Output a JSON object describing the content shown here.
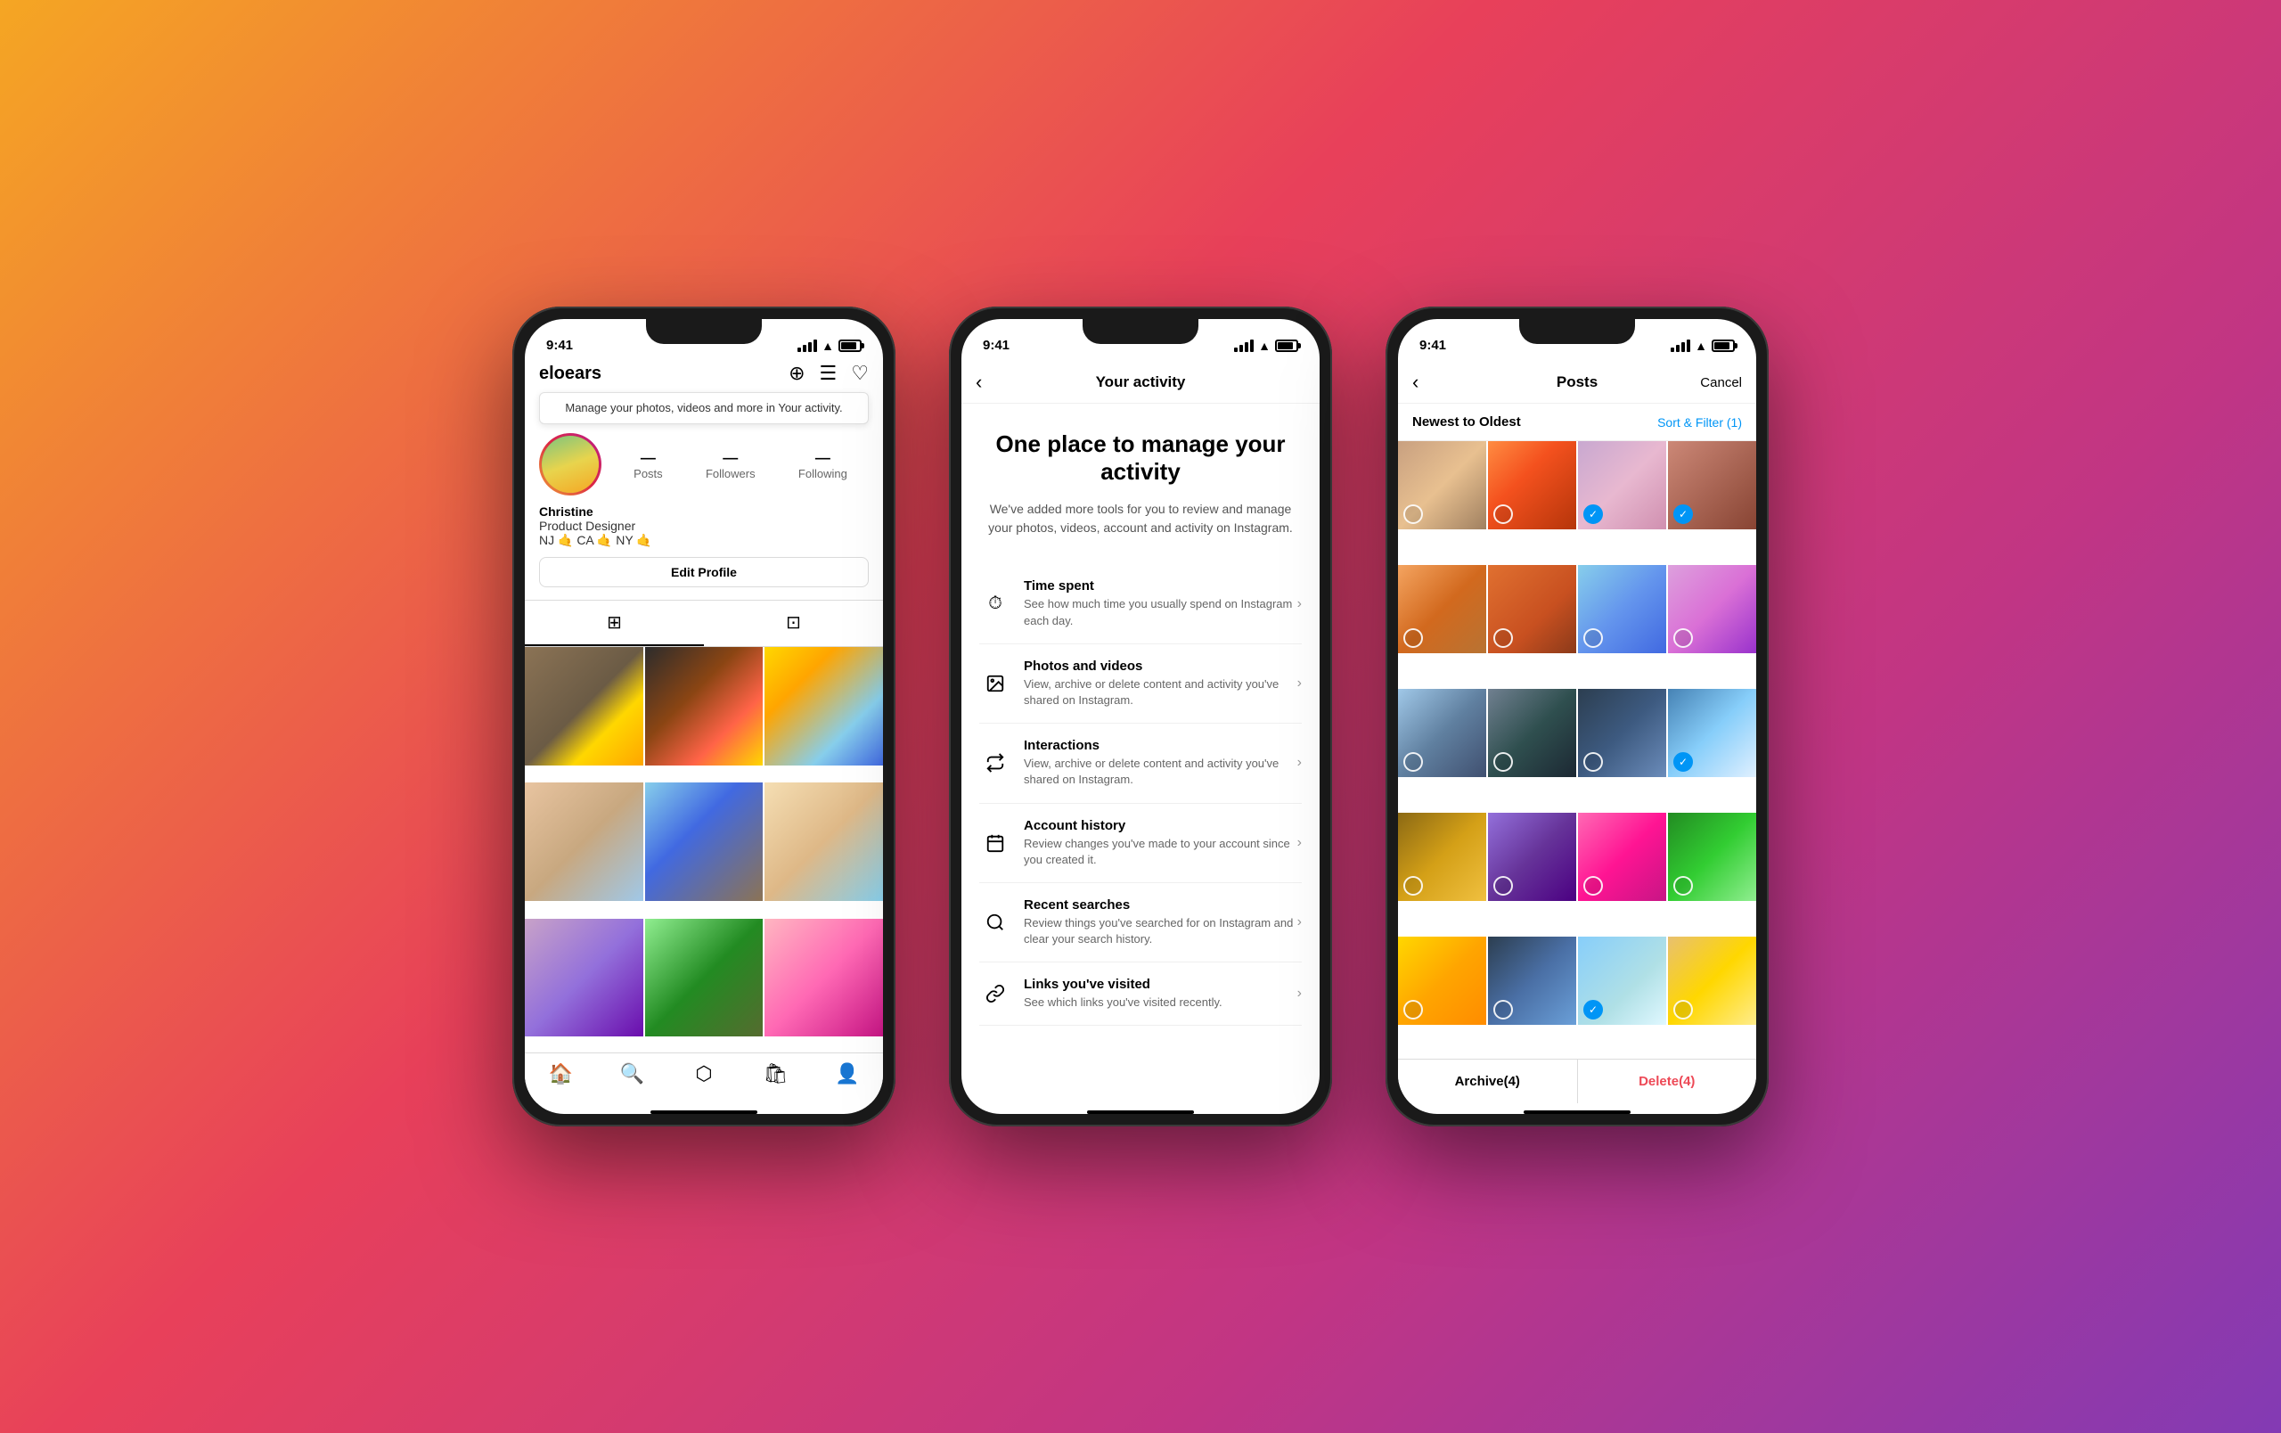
{
  "background": {
    "gradient": "linear-gradient(135deg, #f5a623 0%, #e8405a 40%, #c13584 70%, #833ab4 100%)"
  },
  "phone1": {
    "status": {
      "time": "9:41",
      "battery_full": true
    },
    "header": {
      "username": "eloears",
      "add_icon": "+",
      "menu_icon": "☰",
      "heart_icon": "♡"
    },
    "tooltip": {
      "text": "Manage your photos, videos and more in Your activity."
    },
    "stats": {
      "posts_label": "Posts",
      "followers_label": "Followers",
      "following_label": "Following"
    },
    "bio": {
      "name": "Christine",
      "job": "Product Designer",
      "location": "NJ 🤙 CA 🤙 NY 🤙"
    },
    "edit_profile_btn": "Edit Profile",
    "tabs": {
      "grid_icon": "⊞",
      "tagged_icon": "👤"
    },
    "nav": {
      "home": "🏠",
      "search": "🔍",
      "reels": "🎬",
      "shop": "🛍",
      "profile": "👤"
    }
  },
  "phone2": {
    "status": {
      "time": "9:41"
    },
    "header": {
      "back_icon": "‹",
      "title": "Your activity"
    },
    "hero": {
      "title": "One place to manage your activity",
      "subtitle": "We've added more tools for you to review and manage your photos, videos, account and activity on Instagram."
    },
    "menu_items": [
      {
        "icon": "⏱",
        "title": "Time spent",
        "description": "See how much time you usually spend on Instagram each day."
      },
      {
        "icon": "🖼",
        "title": "Photos and videos",
        "description": "View, archive or delete content and activity you've shared on Instagram."
      },
      {
        "icon": "↔",
        "title": "Interactions",
        "description": "View, archive or delete content and activity you've shared on Instagram."
      },
      {
        "icon": "📅",
        "title": "Account history",
        "description": "Review changes you've made to your account since you created it."
      },
      {
        "icon": "🔍",
        "title": "Recent searches",
        "description": "Review things you've searched for on Instagram and clear your search history."
      },
      {
        "icon": "🔗",
        "title": "Links you've visited",
        "description": "See which links you've visited recently."
      }
    ]
  },
  "phone3": {
    "status": {
      "time": "9:41"
    },
    "header": {
      "back_icon": "‹",
      "title": "Posts",
      "cancel_label": "Cancel"
    },
    "filter_bar": {
      "label": "Newest to Oldest",
      "sort_filter": "Sort & Filter (1)"
    },
    "photos": [
      {
        "class": "g1",
        "selected": false
      },
      {
        "class": "g2",
        "selected": false
      },
      {
        "class": "g3",
        "selected": true
      },
      {
        "class": "g4",
        "selected": true
      },
      {
        "class": "g5",
        "selected": false
      },
      {
        "class": "g6",
        "selected": false
      },
      {
        "class": "g7",
        "selected": false
      },
      {
        "class": "g8",
        "selected": false
      },
      {
        "class": "g9",
        "selected": false
      },
      {
        "class": "g10",
        "selected": false
      },
      {
        "class": "g11",
        "selected": false
      },
      {
        "class": "g12",
        "selected": true
      },
      {
        "class": "g13",
        "selected": false
      },
      {
        "class": "g14",
        "selected": false
      },
      {
        "class": "g15",
        "selected": false
      },
      {
        "class": "g16",
        "selected": false
      },
      {
        "class": "g17",
        "selected": false
      },
      {
        "class": "g18",
        "selected": false
      },
      {
        "class": "g19",
        "selected": true
      },
      {
        "class": "g20",
        "selected": false
      }
    ],
    "actions": {
      "archive": "Archive(4)",
      "delete": "Delete(4)"
    }
  }
}
